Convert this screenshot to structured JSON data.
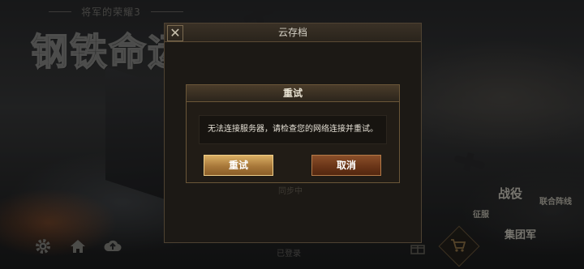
{
  "background": {
    "logo_subtitle": "将军的荣耀3",
    "logo_title": "钢铁命运",
    "menu": {
      "battle": "战役",
      "alliance": "联合阵线",
      "expedition": "征服",
      "corps": "集团军"
    },
    "bottom_text": "已登录",
    "icons": [
      "gear-icon",
      "home-icon",
      "cloud-icon",
      "gift-icon",
      "cart-icon"
    ]
  },
  "cloud_dialog": {
    "title": "云存档",
    "close_symbol": "✕",
    "faded_text": "同步中"
  },
  "retry_dialog": {
    "title": "重试",
    "message": "无法连接服务器，请检查您的网络连接并重试。",
    "retry_label": "重试",
    "cancel_label": "取消"
  },
  "colors": {
    "accent_gold": "#d9ae63",
    "cancel_brown": "#6b3618",
    "dialog_border": "#6a5638"
  }
}
